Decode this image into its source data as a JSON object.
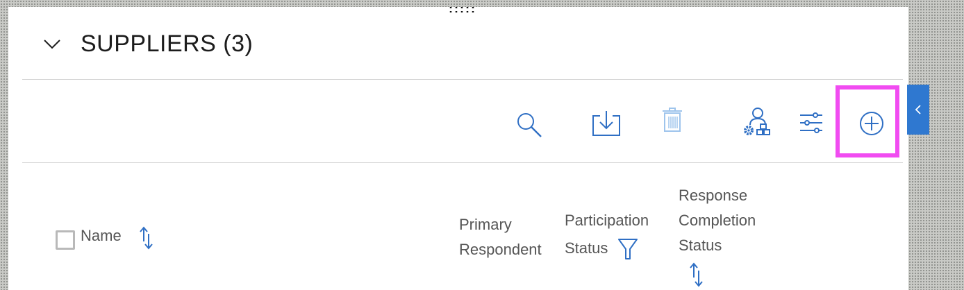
{
  "section": {
    "title": "SUPPLIERS (3)"
  },
  "toolbar": {
    "icons": [
      "search-icon",
      "download-icon",
      "trash-icon",
      "assign-user-icon",
      "settings-sliders-icon",
      "add-circle-icon"
    ],
    "delete_disabled": true
  },
  "table": {
    "columns": {
      "name": "Name",
      "primary_respondent_line1": "Primary",
      "primary_respondent_line2": "Respondent",
      "participation_status_line1": "Participation",
      "participation_status_line2": "Status",
      "response_completion_line1": "Response",
      "response_completion_line2": "Completion",
      "response_completion_line3": "Status"
    }
  },
  "colors": {
    "accent": "#2f6fc4",
    "icon_disabled": "#9ec4ec",
    "highlight": "#f14cf1",
    "side_tab": "#2f78d0"
  }
}
